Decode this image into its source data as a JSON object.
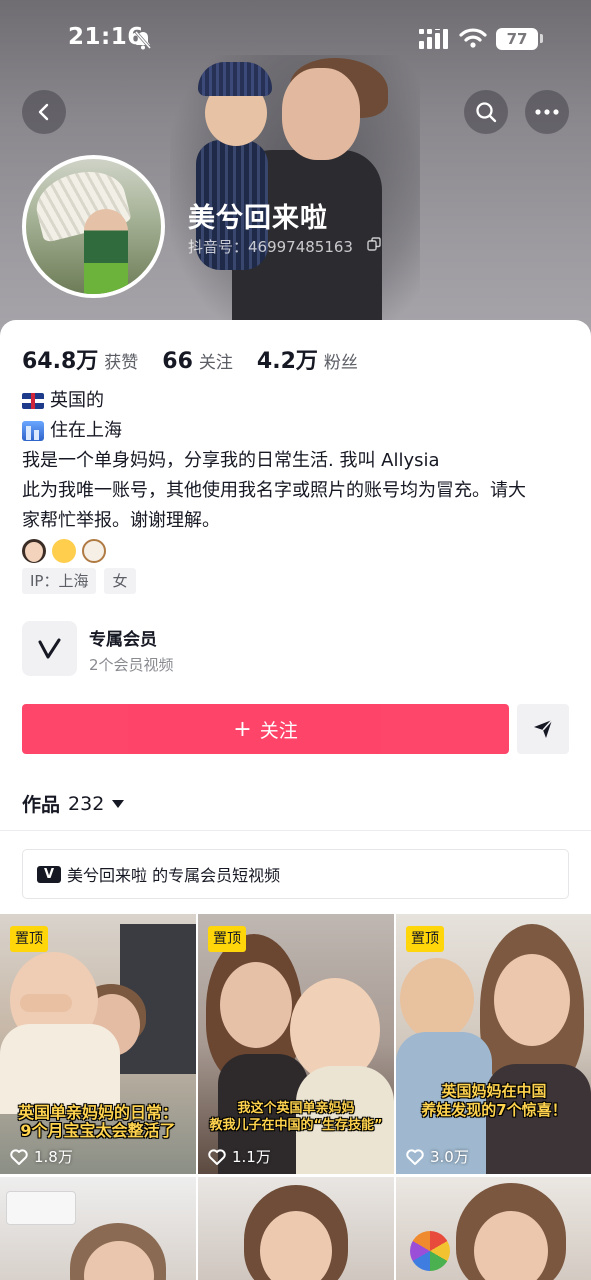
{
  "status_bar": {
    "time": "21:16",
    "battery": "77"
  },
  "profile": {
    "nickname": "美兮回来啦",
    "douyin_id": "抖音号：46997485163"
  },
  "stats": [
    {
      "value": "64.8万",
      "label": "获赞"
    },
    {
      "value": "66",
      "label": "关注"
    },
    {
      "value": "4.2万",
      "label": "粉丝"
    }
  ],
  "bio": {
    "line1": "英国的",
    "line2": "住在上海",
    "line3": "我是一个单身妈妈，分享我的日常生活. 我叫 Allysia",
    "line4": "此为我唯一账号，其他使用我名字或照片的账号均为冒充。请大",
    "line5": "家帮忙举报。谢谢理解。"
  },
  "tags": [
    "IP：上海",
    "女"
  ],
  "member": {
    "title": "专属会员",
    "subtitle": "2个会员视频"
  },
  "actions": {
    "follow_label": "关注"
  },
  "works_tab": {
    "label": "作品",
    "count": "232"
  },
  "member_bar": {
    "text": "美兮回来啦 的专属会员短视频"
  },
  "videos": [
    {
      "pinned": "置顶",
      "caption_line1": "英国单亲妈妈的日常：",
      "caption_line2": "9个月宝宝太会整活了",
      "likes": "1.8万"
    },
    {
      "pinned": "置顶",
      "caption_line1": "我这个英国单亲妈妈",
      "caption_line2": "教我儿子在中国的“生存技能”",
      "likes": "1.1万"
    },
    {
      "pinned": "置顶",
      "caption_line1": "英国妈妈在中国",
      "caption_line2": "养娃发现的7个惊喜！",
      "likes": "3.0万"
    }
  ],
  "icons": {
    "back": "chevron-left-icon",
    "search": "search-icon",
    "more": "more-icon",
    "share": "share-icon",
    "like": "heart-icon"
  }
}
